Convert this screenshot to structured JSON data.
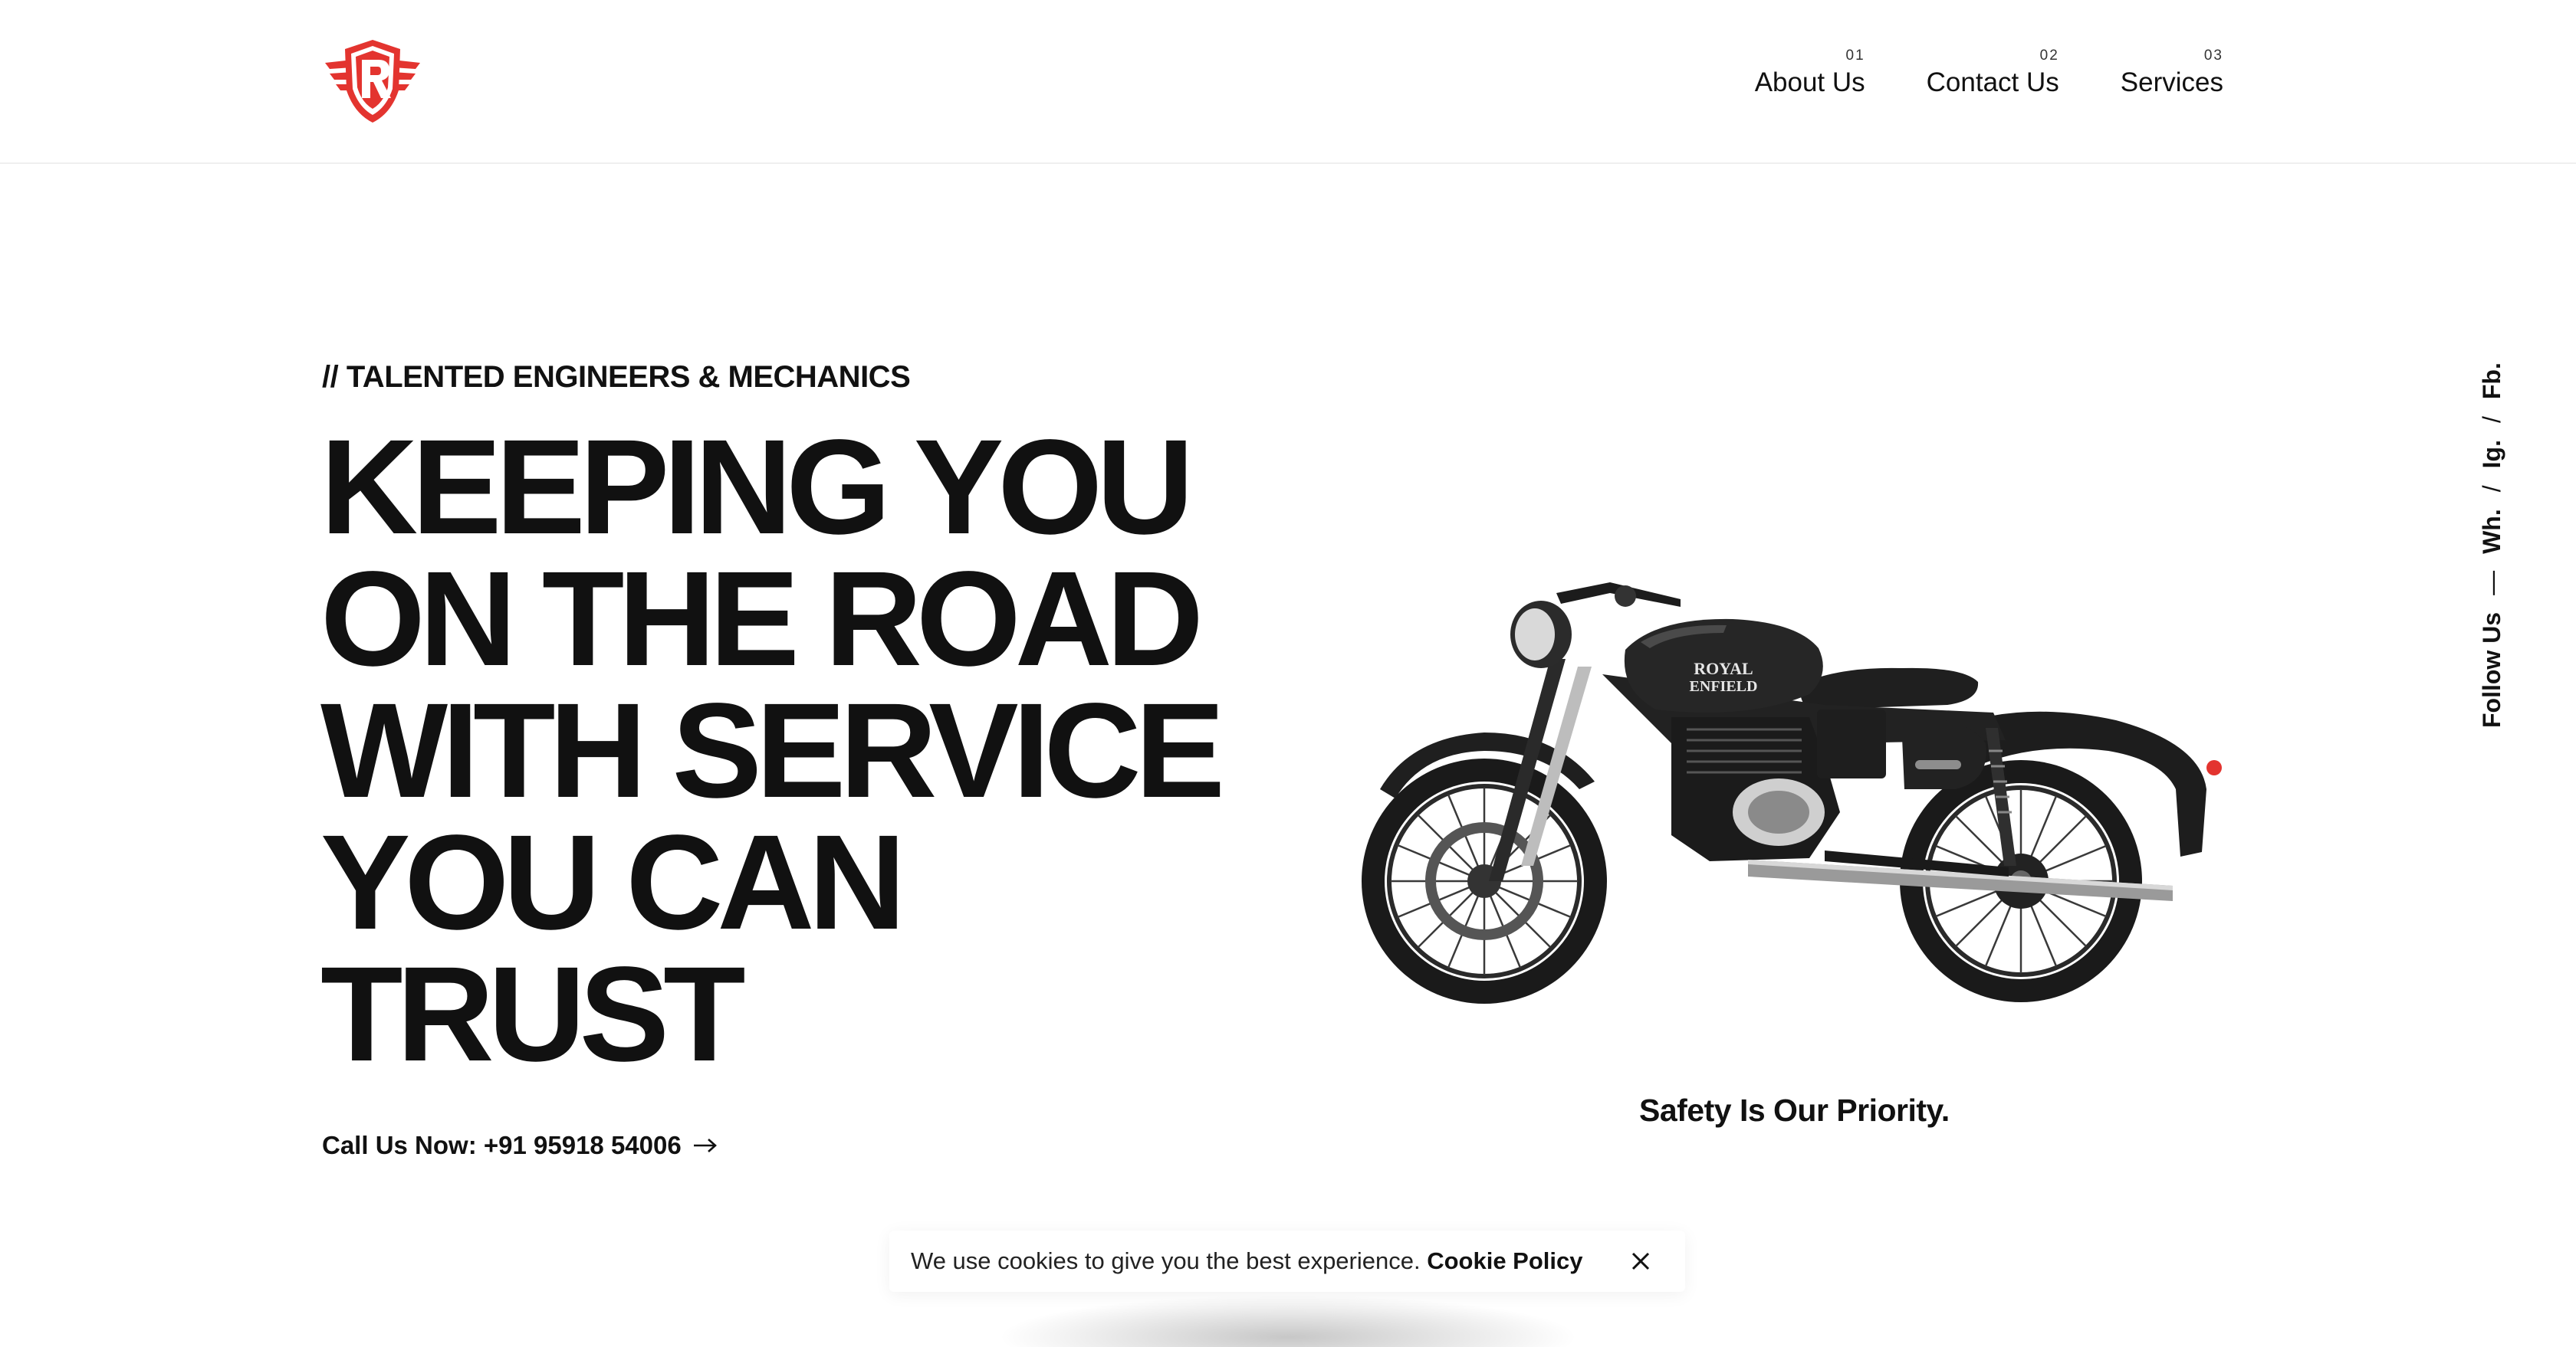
{
  "header": {
    "logo_alt": "R",
    "nav": [
      {
        "num": "01",
        "label": "About Us"
      },
      {
        "num": "02",
        "label": "Contact Us"
      },
      {
        "num": "03",
        "label": "Services"
      }
    ]
  },
  "hero": {
    "eyebrow": "// TALENTED ENGINEERS & MECHANICS",
    "headline_lines": [
      "KEEPING YOU",
      "ON THE ROAD",
      "WITH SERVICE",
      "YOU CAN",
      "TRUST"
    ],
    "call_label": "Call Us Now: +91 95918 54006",
    "call_icon": "arrow-right-icon",
    "bike_image": "motorcycle-image",
    "tank_badge_line1": "ROYAL",
    "tank_badge_line2": "ENFIELD",
    "caption": "Safety Is Our Priority."
  },
  "social": {
    "label": "Follow Us",
    "dash": "—",
    "links": [
      "Wh.",
      "Ig.",
      "Fb."
    ],
    "separator": "/"
  },
  "cookie": {
    "text": "We use cookies to give you the best experience.",
    "policy_label": "Cookie Policy",
    "close_icon": "close-icon"
  },
  "colors": {
    "brand_red": "#e3342f",
    "text": "#111111",
    "background": "#ffffff"
  }
}
